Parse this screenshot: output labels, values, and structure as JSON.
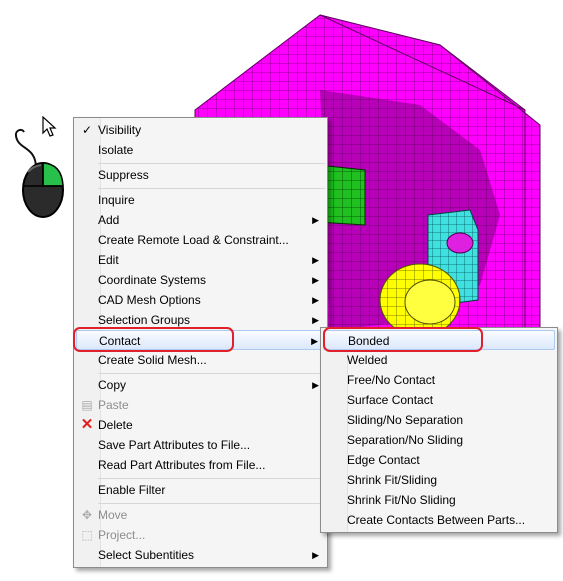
{
  "context_menu": {
    "items": [
      {
        "label": "Visibility",
        "checked": true
      },
      {
        "label": "Isolate"
      },
      {
        "label": "Suppress"
      },
      {
        "label": "Inquire"
      },
      {
        "label": "Add",
        "submenu": true
      },
      {
        "label": "Create Remote Load & Constraint..."
      },
      {
        "label": "Edit",
        "submenu": true
      },
      {
        "label": "Coordinate Systems",
        "submenu": true
      },
      {
        "label": "CAD Mesh Options",
        "submenu": true
      },
      {
        "label": "Selection Groups",
        "submenu": true
      },
      {
        "label": "Contact",
        "submenu": true,
        "highlighted": true
      },
      {
        "label": "Create Solid Mesh..."
      },
      {
        "label": "Copy",
        "submenu": true
      },
      {
        "label": "Paste",
        "disabled": true
      },
      {
        "label": "Delete",
        "icon": "red-x-icon"
      },
      {
        "label": "Save Part Attributes to File..."
      },
      {
        "label": "Read Part Attributes from File..."
      },
      {
        "label": "Enable Filter"
      },
      {
        "label": "Move",
        "disabled": true
      },
      {
        "label": "Project...",
        "disabled": true
      },
      {
        "label": "Select Subentities",
        "submenu": true
      }
    ]
  },
  "contact_submenu": {
    "items": [
      {
        "label": "Bonded",
        "highlighted": true
      },
      {
        "label": "Welded"
      },
      {
        "label": "Free/No Contact"
      },
      {
        "label": "Surface Contact"
      },
      {
        "label": "Sliding/No Separation"
      },
      {
        "label": "Separation/No Sliding"
      },
      {
        "label": "Edge Contact"
      },
      {
        "label": "Shrink Fit/Sliding"
      },
      {
        "label": "Shrink Fit/No Sliding"
      },
      {
        "label": "Create Contacts Between Parts..."
      }
    ]
  },
  "icons": {
    "mouse": "mouse-right-click-icon",
    "cursor": "arrow-cursor-icon",
    "check": "checkmark-icon",
    "submenu_arrow": "submenu-arrow-icon"
  },
  "colors": {
    "mesh_magenta": "#ff00ff",
    "mesh_yellow": "#ffff00",
    "mesh_cyan": "#40e0e0",
    "mesh_green": "#20c020",
    "highlight_box": "#e0202a",
    "mouse_button_green": "#27c04a"
  }
}
